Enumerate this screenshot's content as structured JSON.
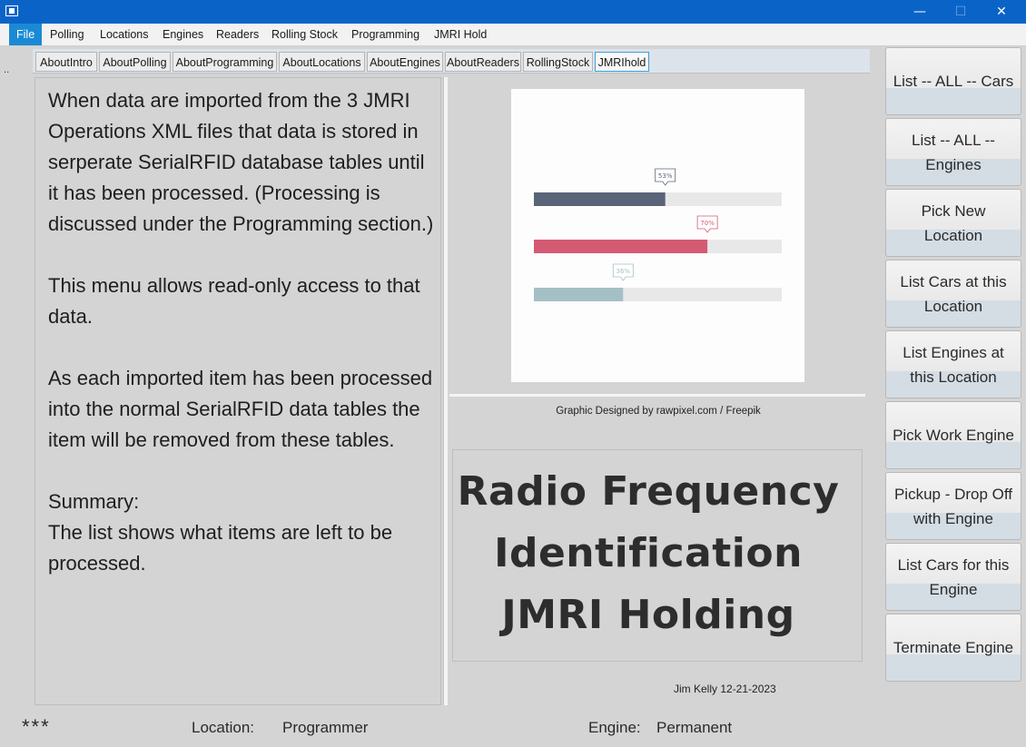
{
  "window": {
    "controls": {
      "minimize": "—",
      "maximize": "☐",
      "close": "✕"
    }
  },
  "menubar": {
    "items": [
      "File",
      "Polling",
      "Locations",
      "Engines",
      "Readers",
      "Rolling Stock",
      "Programming",
      "JMRI Hold"
    ],
    "active": "File"
  },
  "tabs": {
    "items": [
      "AboutIntro",
      "AboutPolling",
      "AboutProgramming",
      "AboutLocations",
      "AboutEngines",
      "AboutReaders",
      "RollingStock",
      "JMRIhold"
    ],
    "selected": "JMRIhold"
  },
  "side_marker": "..",
  "main_text": "When data are imported from the 3 JMRI Operations XML files that data is stored in serperate SerialRFID database tables until it has been processed. (Processing is discussed under the Programming section.)\n\nThis menu allows read-only access to that data.\n\nAs each imported item has been processed into the normal SerialRFID data tables the item will be removed from these tables.\n\nSummary:\nThe list shows what items are left to be processed.",
  "graphic": {
    "bars": [
      {
        "label": "53%",
        "value": 0.53,
        "color": "#5a6478"
      },
      {
        "label": "70%",
        "value": 0.7,
        "color": "#d45a74"
      },
      {
        "label": "36%",
        "value": 0.36,
        "color": "#a4c0c4"
      }
    ],
    "track_color": "#e8e8e8"
  },
  "credit": "Graphic Designed by rawpixel.com / Freepik",
  "title_lines": [
    "Radio Frequency",
    "Identification",
    "JMRI Holding"
  ],
  "author": "Jim Kelly 12-21-2023",
  "sidebar": {
    "buttons": [
      "List -- ALL -- Cars",
      "List -- ALL -- Engines",
      "Pick New Location",
      "List Cars at this Location",
      "List Engines at this Location",
      "Pick Work Engine",
      "Pickup - Drop Off with Engine",
      "List Cars for this Engine",
      "Terminate Engine"
    ]
  },
  "status": {
    "stars": "***",
    "location_label": "Location:",
    "location_value": "Programmer",
    "engine_label": "Engine:",
    "engine_value": "Permanent"
  }
}
